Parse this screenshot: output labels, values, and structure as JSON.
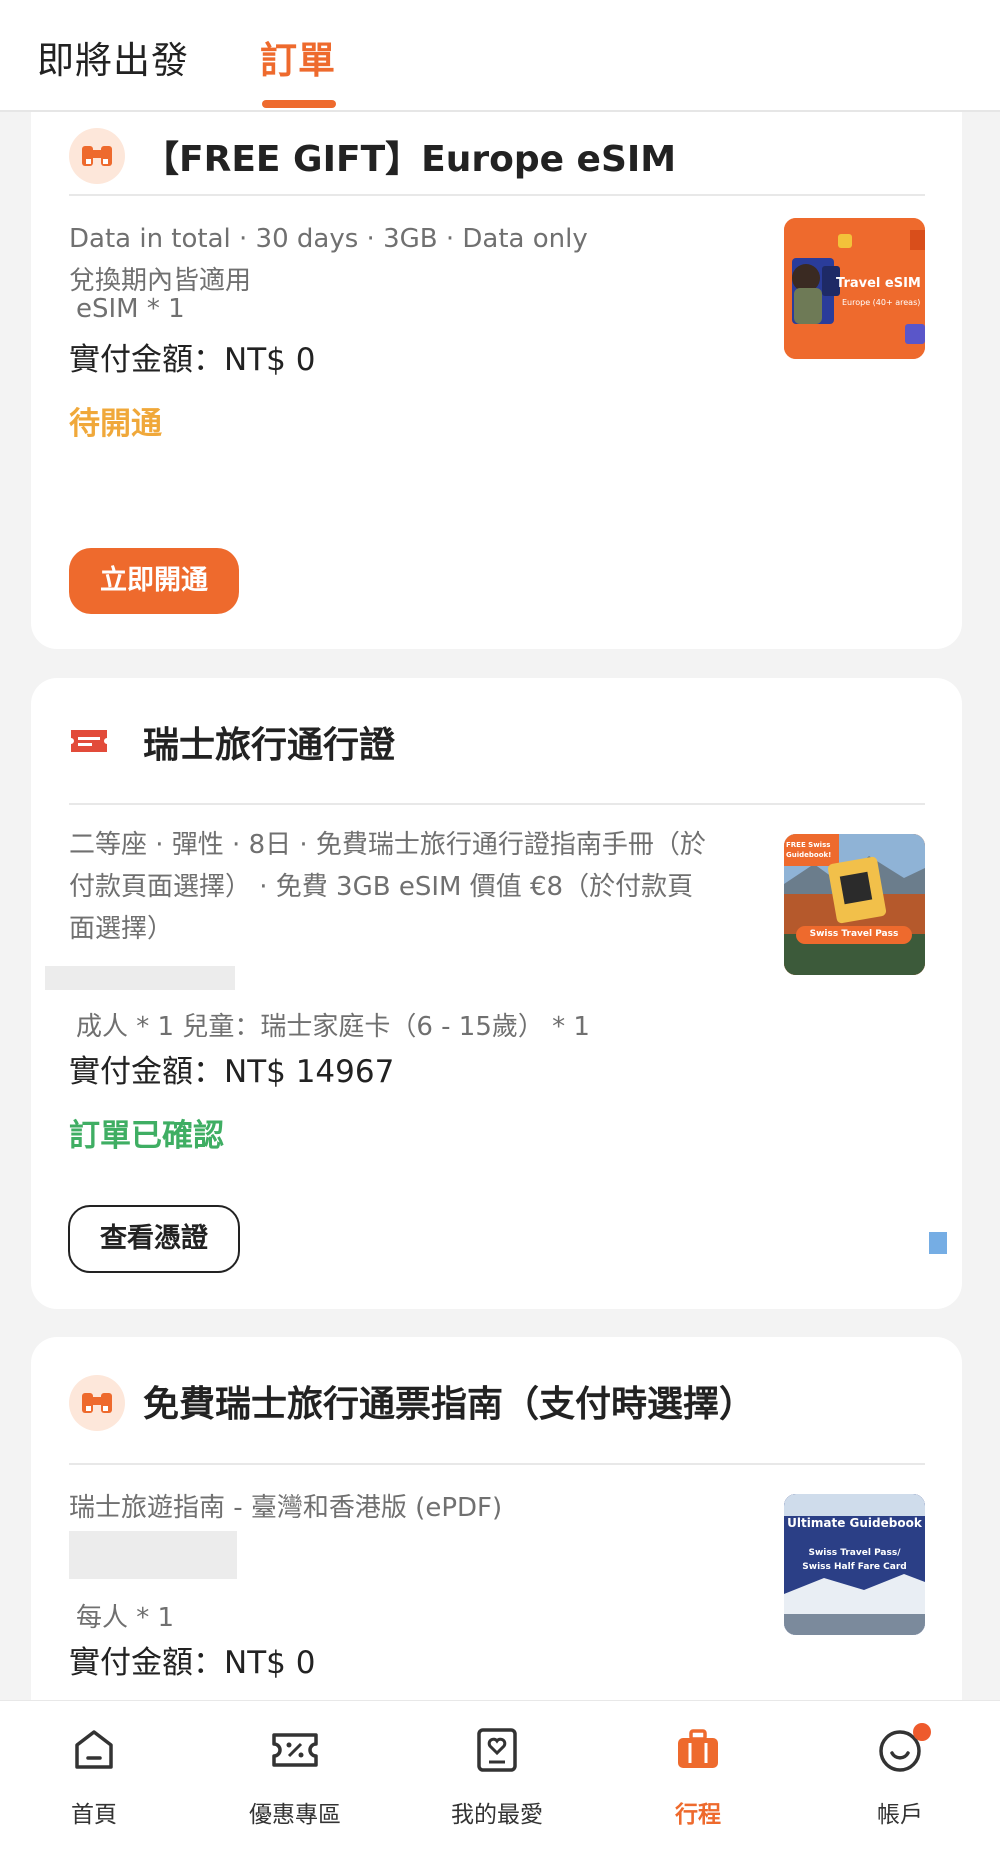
{
  "tabs": {
    "upcoming": "即將出發",
    "orders": "訂單"
  },
  "orders": [
    {
      "title": "【FREE GIFT】Europe eSIM",
      "desc_line1": "Data in total · 30 days · 3GB · Data only",
      "desc_line2": "兌換期內皆適用",
      "quantity": "eSIM * 1",
      "price": "實付金額：NT$ 0",
      "status": "待開通",
      "action": "立即開通",
      "thumb_title": "Travel eSIM",
      "thumb_sub": "Europe (40+ areas)"
    },
    {
      "title": "瑞士旅行通行證",
      "desc_line1": "二等座 · 彈性 · 8日 · 免費瑞士旅行通行證指南手冊（於",
      "desc_line2": "付款頁面選擇） · 免費 3GB eSIM 價值 €8（於付款頁",
      "desc_line3": "面選擇）",
      "quantity": "成人 * 1 兒童：瑞士家庭卡（6 - 15歲） * 1",
      "price": "實付金額：NT$ 14967",
      "status": "訂單已確認",
      "action": "查看憑證",
      "thumb_tag": "FREE Swiss Guidebook!",
      "thumb_label": "Swiss Travel Pass"
    },
    {
      "title": "免費瑞士旅行通票指南（支付時選擇）",
      "desc_line1": "瑞士旅遊指南 - 臺灣和香港版 (ePDF)",
      "quantity": "每人 * 1",
      "price": "實付金額：NT$ 0",
      "thumb_title": "Ultimate Guidebook",
      "thumb_sub1": "Swiss Travel Pass/",
      "thumb_sub2": "Swiss Half Fare Card"
    }
  ],
  "bottom_nav": [
    {
      "label": "首頁",
      "icon": "home-icon"
    },
    {
      "label": "優惠專區",
      "icon": "coupon-icon"
    },
    {
      "label": "我的最愛",
      "icon": "favorites-icon"
    },
    {
      "label": "行程",
      "icon": "suitcase-icon"
    },
    {
      "label": "帳戶",
      "icon": "account-icon"
    }
  ],
  "colors": {
    "accent": "#ee6a2d",
    "pending": "#f0a83a",
    "confirmed": "#3fae63"
  }
}
